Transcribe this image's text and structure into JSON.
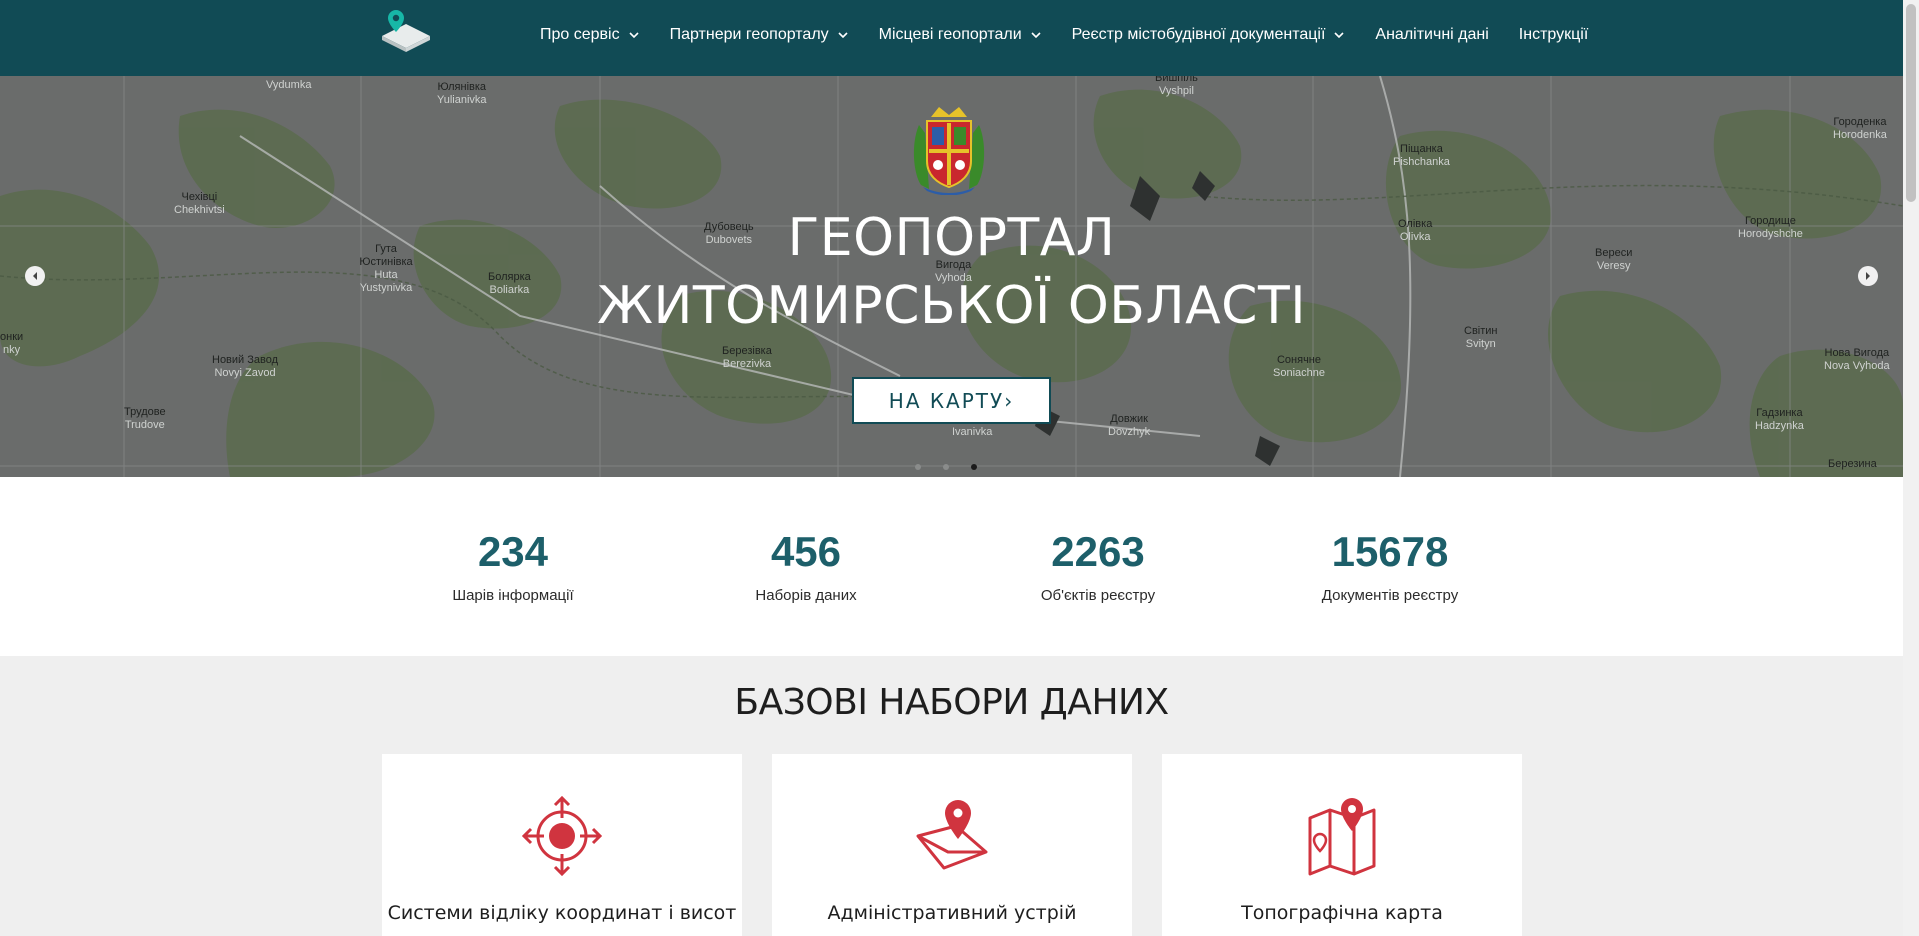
{
  "nav": {
    "items": [
      {
        "label": "Про сервіс",
        "dropdown": true
      },
      {
        "label": "Партнери геопорталу",
        "dropdown": true
      },
      {
        "label": "Місцеві геопортали",
        "dropdown": true
      },
      {
        "label": "Реєстр містобудівної документації",
        "dropdown": true
      },
      {
        "label": "Аналітичні дані",
        "dropdown": false
      },
      {
        "label": "Інструкції",
        "dropdown": false
      }
    ]
  },
  "hero": {
    "title_line1": "ГЕОПОРТАЛ",
    "title_line2": "ЖИТОМИРСЬКОЇ ОБЛАСТІ",
    "button_label": "НА КАРТУ›",
    "active_slide": 3,
    "slide_count": 3,
    "map_labels": [
      {
        "ua": "",
        "lat": "Vydumka"
      },
      {
        "ua": "Юлянівка",
        "lat": "Yulianivka"
      },
      {
        "ua": "Вишпіль",
        "lat": "Vyshpil"
      },
      {
        "ua": "Городенка",
        "lat": "Horodenka"
      },
      {
        "ua": "Піщанка",
        "lat": "Pishchanka"
      },
      {
        "ua": "Чехівці",
        "lat": "Chekhivtsi"
      },
      {
        "ua": "Дубовець",
        "lat": "Dubovets"
      },
      {
        "ua": "Гута Юстинівка",
        "lat": "Huta Yustynivka"
      },
      {
        "ua": "Болярка",
        "lat": "Boliarka"
      },
      {
        "ua": "Вигода",
        "lat": "Vyhoda"
      },
      {
        "ua": "Олівка",
        "lat": "Olivka"
      },
      {
        "ua": "Городище",
        "lat": "Horodyshche"
      },
      {
        "ua": "Вереси",
        "lat": "Veresy"
      },
      {
        "ua": "Світин",
        "lat": "Svityn"
      },
      {
        "ua": "Березівка",
        "lat": "Berezivka"
      },
      {
        "ua": "Новий Завод",
        "lat": "Novyi Zavod"
      },
      {
        "ua": "Нова Вигода",
        "lat": "Nova Vyhoda"
      },
      {
        "ua": "Сонячне",
        "lat": "Soniachne"
      },
      {
        "ua": "Трудове",
        "lat": "Trudove"
      },
      {
        "ua": "Довжик",
        "lat": "Dovzhyk"
      },
      {
        "ua": "",
        "lat": "Ivanivka"
      },
      {
        "ua": "Гадзинка",
        "lat": "Hadzynka"
      },
      {
        "ua": "Березина",
        "lat": ""
      },
      {
        "ua": "онки",
        "lat": "nky"
      }
    ]
  },
  "stats": [
    {
      "value": "234",
      "label": "Шарів інформації"
    },
    {
      "value": "456",
      "label": "Наборів даних"
    },
    {
      "value": "2263",
      "label": "Об'єктів реєстру"
    },
    {
      "value": "15678",
      "label": "Документів реєстру"
    }
  ],
  "datasets": {
    "title": "БАЗОВІ НАБОРИ ДАНИХ",
    "cards": [
      {
        "label": "Системи відліку координат і висот",
        "icon": "crosshair-target-icon"
      },
      {
        "label": "Адміністративний устрій",
        "icon": "map-pin-envelope-icon"
      },
      {
        "label": "Топографічна карта",
        "icon": "folded-map-pin-icon"
      }
    ]
  },
  "colors": {
    "navbar": "#114b55",
    "accent": "#1d5f6a",
    "icon_red": "#d0343f",
    "section_bg": "#efefef"
  }
}
